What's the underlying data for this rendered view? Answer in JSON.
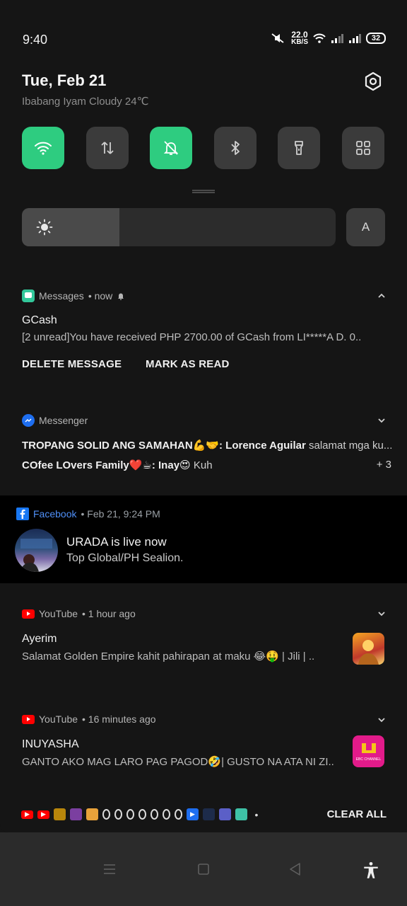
{
  "status_bar": {
    "time": "9:40",
    "net_speed_value": "22.0",
    "net_speed_unit": "KB/S",
    "battery": "32"
  },
  "header": {
    "date": "Tue, Feb 21",
    "weather": "Ibabang Iyam Cloudy 24℃"
  },
  "quick_tiles": [
    {
      "name": "wifi",
      "icon": "wifi-icon",
      "active": true
    },
    {
      "name": "mobile-data",
      "icon": "data-arrows-icon",
      "active": false
    },
    {
      "name": "silent",
      "icon": "bell-off-icon",
      "active": true
    },
    {
      "name": "bluetooth",
      "icon": "bluetooth-icon",
      "active": false
    },
    {
      "name": "flashlight",
      "icon": "flashlight-icon",
      "active": false
    },
    {
      "name": "more",
      "icon": "grid-icon",
      "active": false
    }
  ],
  "brightness": {
    "level": 0.31,
    "auto_label": "A"
  },
  "notifications": {
    "messages": {
      "app": "Messages",
      "time": "• now",
      "title": "GCash",
      "text": "[2 unread]You have received PHP 2700.00 of GCash from LI*****A D. 0..",
      "actions": [
        "DELETE MESSAGE",
        "MARK AS READ"
      ]
    },
    "messenger": {
      "app": "Messenger",
      "line1_bold": "TROPANG SOLID ANG SAMAHAN💪🤝: Lorence Aguilar",
      "line1_text": "salamat mga ku...",
      "line2_bold": "COfee LOvers Family❤️☕: Inay😍",
      "line2_text": "Kuh",
      "more": "+ 3"
    },
    "facebook": {
      "app": "Facebook",
      "time": "•  Feb 21, 9:24 PM",
      "title": "URADA is live now",
      "text": "Top Global/PH Sealion."
    },
    "youtube1": {
      "app": "YouTube",
      "time": "• 1 hour ago",
      "title": "Ayerim",
      "text": "Salamat Golden Empire kahit pahirapan at maku 😂🤑 | Jili | .."
    },
    "youtube2": {
      "app": "YouTube",
      "time": "• 16 minutes ago",
      "title": "INUYASHA",
      "text": "GANTO AKO MAG LARO PAG PAGOD🤣| GUSTO NA ATA NI ZI..",
      "thumb_label": "EBC CHANNEL"
    }
  },
  "tray": {
    "clear_all": "CLEAR ALL"
  },
  "colors": {
    "accent": "#2ecc80",
    "youtube": "#ff0000",
    "facebook": "#1877f2"
  }
}
